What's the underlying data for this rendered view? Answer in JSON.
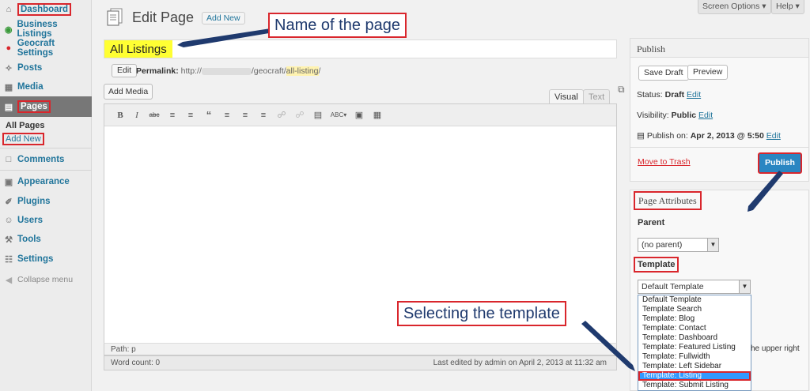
{
  "sidebar": {
    "dashboard": "Dashboard",
    "business_listings": "Business Listings",
    "geocraft_settings": "Geocraft Settings",
    "posts": "Posts",
    "media": "Media",
    "pages": "Pages",
    "all_pages": "All Pages",
    "add_new": "Add New",
    "comments": "Comments",
    "appearance": "Appearance",
    "plugins": "Plugins",
    "users": "Users",
    "tools": "Tools",
    "settings": "Settings",
    "collapse": "Collapse menu"
  },
  "header": {
    "title": "Edit Page",
    "add_new": "Add New",
    "screen_options": "Screen Options",
    "help": "Help"
  },
  "post": {
    "title": "All Listings",
    "edit_permalink": "Edit",
    "permalink_label": "Permalink:",
    "permalink_prefix": "http://",
    "permalink_mid": "/geocraft/",
    "permalink_slug": "all-listing",
    "permalink_suffix": "/"
  },
  "editor": {
    "add_media": "Add Media",
    "tab_visual": "Visual",
    "tab_text": "Text",
    "path": "Path: p",
    "word_count": "Word count: 0",
    "last_edited": "Last edited by admin on April 2, 2013 at 11:32 am"
  },
  "publish": {
    "title": "Publish",
    "save_draft": "Save Draft",
    "preview": "Preview",
    "status_label": "Status:",
    "status_value": "Draft",
    "visibility_label": "Visibility:",
    "visibility_value": "Public",
    "publish_on_label": "Publish on:",
    "publish_on_value": "Apr 2, 2013 @ 5:50",
    "edit": "Edit",
    "move_to_trash": "Move to Trash",
    "publish_button": "Publish"
  },
  "attributes": {
    "title": "Page Attributes",
    "parent_label": "Parent",
    "parent_value": "(no parent)",
    "template_label": "Template",
    "template_value": "Default Template",
    "template_options": [
      "Default Template",
      "Template Search",
      "Template: Blog",
      "Template: Contact",
      "Template: Dashboard",
      "Template: Featured Listing",
      "Template: Fullwidth",
      "Template: Left Sidebar",
      "Template: Listing",
      "Template: Submit Listing"
    ],
    "selected_index": 8,
    "help_fragment": "he upper right"
  },
  "callouts": {
    "page_name": "Name of the page",
    "select_template": "Selecting the template"
  },
  "icons": {
    "dashboard": "home-icon",
    "page": "page-icon",
    "publish_date": "calendar-icon"
  },
  "colors": {
    "link": "#21759b",
    "highlight": "#d9262c",
    "publish": "#2a86c2",
    "title_highlight": "#ffff33",
    "callout_text": "#1f3a6e"
  }
}
